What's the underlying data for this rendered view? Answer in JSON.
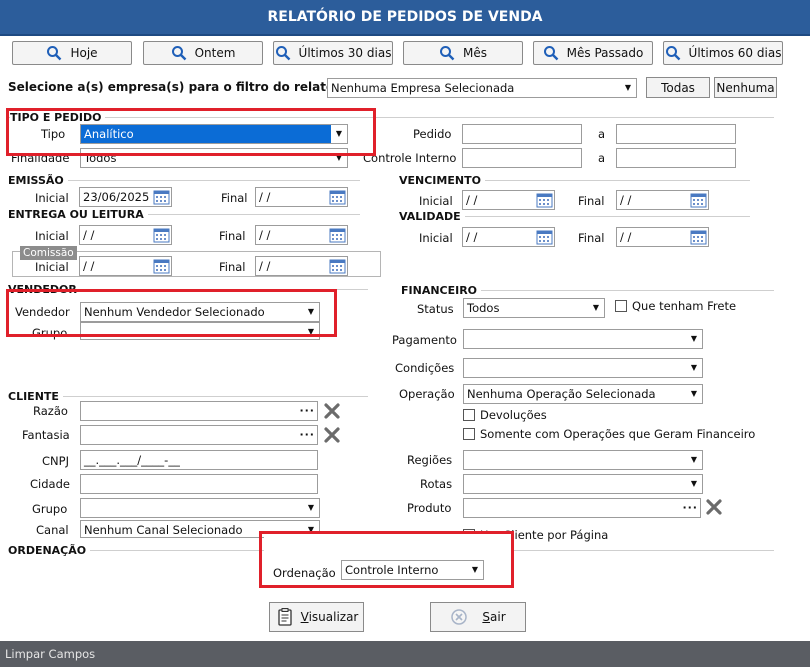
{
  "title": "RELATÓRIO DE PEDIDOS DE VENDA",
  "quick_buttons": [
    "Hoje",
    "Ontem",
    "Últimos 30 dias",
    "Mês",
    "Mês Passado",
    "Últimos 60 dias"
  ],
  "empresa": {
    "label": "Selecione a(s) empresa(s) para o filtro do relatório",
    "value": "Nenhuma Empresa Selecionada",
    "todas": "Todas",
    "nenhuma": "Nenhuma"
  },
  "tipo_pedido": {
    "section": "TIPO E PEDIDO",
    "tipo_label": "Tipo",
    "tipo_value": "Analítico",
    "finalidade_label": "Finalidade",
    "finalidade_value": "Todos",
    "pedido_label": "Pedido",
    "controle_label": "Controle Interno",
    "a": "a"
  },
  "emissao": {
    "section": "EMISSÃO",
    "inicial_label": "Inicial",
    "inicial_value": "23/06/2025",
    "final_label": "Final",
    "final_value": " / /"
  },
  "entrega": {
    "section": "ENTREGA OU LEITURA",
    "inicial_label": "Inicial",
    "inicial_value": " / /",
    "final_label": "Final",
    "final_value": " / /"
  },
  "comissao": {
    "section": "Comissão",
    "inicial_label": "Inicial",
    "inicial_value": " / /",
    "final_label": "Final",
    "final_value": " / /"
  },
  "vencimento": {
    "section": "VENCIMENTO",
    "inicial_label": "Inicial",
    "inicial_value": " / /",
    "final_label": "Final",
    "final_value": " / /"
  },
  "validade": {
    "section": "VALIDADE",
    "inicial_label": "Inicial",
    "inicial_value": " / /",
    "final_label": "Final",
    "final_value": " / /"
  },
  "vendedor": {
    "section": "VENDEDOR",
    "vendedor_label": "Vendedor",
    "vendedor_value": "Nenhum Vendedor Selecionado",
    "grupo_label": "Grupo",
    "grupo_value": ""
  },
  "financeiro": {
    "section": "FINANCEIRO",
    "status_label": "Status",
    "status_value": "Todos",
    "frete_label": "Que tenham Frete",
    "pagamento_label": "Pagamento",
    "condicoes_label": "Condições",
    "operacao_label": "Operação",
    "operacao_value": "Nenhuma Operação Selecionada",
    "devolucoes_label": "Devoluções",
    "somente_label": "Somente com Operações que Geram Financeiro"
  },
  "cliente": {
    "section": "CLIENTE",
    "razao_label": "Razão",
    "fantasia_label": "Fantasia",
    "cnpj_label": "CNPJ",
    "cnpj_value": "__.___.___/____-__",
    "cidade_label": "Cidade",
    "grupo_label": "Grupo",
    "canal_label": "Canal",
    "canal_value": "Nenhum Canal Selecionado"
  },
  "outros": {
    "regioes_label": "Regiões",
    "rotas_label": "Rotas",
    "produto_label": "Produto",
    "um_cliente_label": "Um Cliente por Página"
  },
  "ordenacao": {
    "section": "ORDENAÇÃO",
    "label": "Ordenação",
    "value": "Controle Interno"
  },
  "actions": {
    "visualizar_v": "V",
    "visualizar_rest": "isualizar",
    "sair_s": "S",
    "sair_rest": "air"
  },
  "footer": {
    "limpar": "Limpar Campos"
  },
  "colors": {
    "title_bg": "#2c5d9b",
    "highlight": "#e0202a",
    "selected": "#0b6cd6",
    "footer_bg": "#5a5d63"
  }
}
